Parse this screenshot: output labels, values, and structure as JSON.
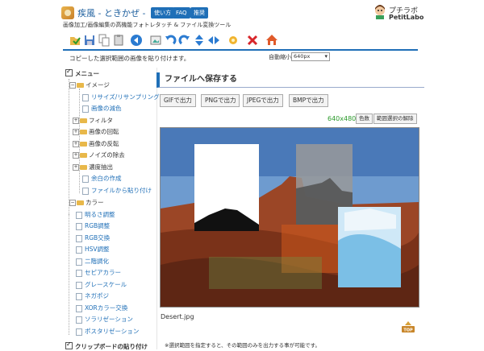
{
  "header": {
    "title": "疾風 - ときかぜ -",
    "subtitle": "画像加工/画像編集の高機能フォトレタッチ & ファイル変換ツール",
    "nav": [
      {
        "label": "使い方"
      },
      {
        "label": "FAQ"
      },
      {
        "label": "推奨"
      }
    ],
    "brand_jp": "プチラボ",
    "brand_en": "PetitLabo"
  },
  "toolbar": {
    "icons": [
      "open-icon",
      "save-icon",
      "copy-icon",
      "paste-icon",
      "back-icon",
      "capture-icon",
      "undo-icon",
      "redo-icon",
      "flip-vertical-icon",
      "flip-horizontal-icon",
      "settings-icon",
      "delete-icon",
      "home-icon"
    ],
    "hint": "コピーした選択範囲の画像を貼り付けます。",
    "shrink_label": "自動縮小",
    "shrink_value": "640px"
  },
  "menu": {
    "title": "メニュー",
    "image_group": "イメージ",
    "image_items": [
      "リサイズ/リサンプリング",
      "画像の減色"
    ],
    "filter": "フィルタ",
    "rotate": "画像の回転",
    "flip": "画像の反転",
    "noise": "ノイズの除去",
    "extract": "濃度抽出",
    "margin": "余白の作成",
    "paste_file": "ファイルから貼り付け",
    "color_group": "カラー",
    "color_items": [
      "明るさ調整",
      "RGB調整",
      "RGB交換",
      "HSV調整",
      "二階調化",
      "セピアカラー",
      "グレースケール",
      "ネガポジ",
      "XORカラー交換",
      "ソラリゼーション",
      "ポスタリゼーション"
    ],
    "clipboard": "クリップボードの貼り付け"
  },
  "main": {
    "save_title": "ファイルへ保存する",
    "formats": [
      "GIFで出力",
      "PNGで出力",
      "JPEGで出力",
      "BMPで出力"
    ],
    "size": "640x480",
    "color_button": "色数",
    "clear_selection": "範囲選択の解除",
    "file_name": "Desert.jpg",
    "top_label": "TOP",
    "footnote": "※選択範囲を指定すると、その範囲のみを出力する事が可能です。"
  },
  "colors": {
    "accent": "#1f6fb7",
    "size_text": "#2a9a2a"
  }
}
